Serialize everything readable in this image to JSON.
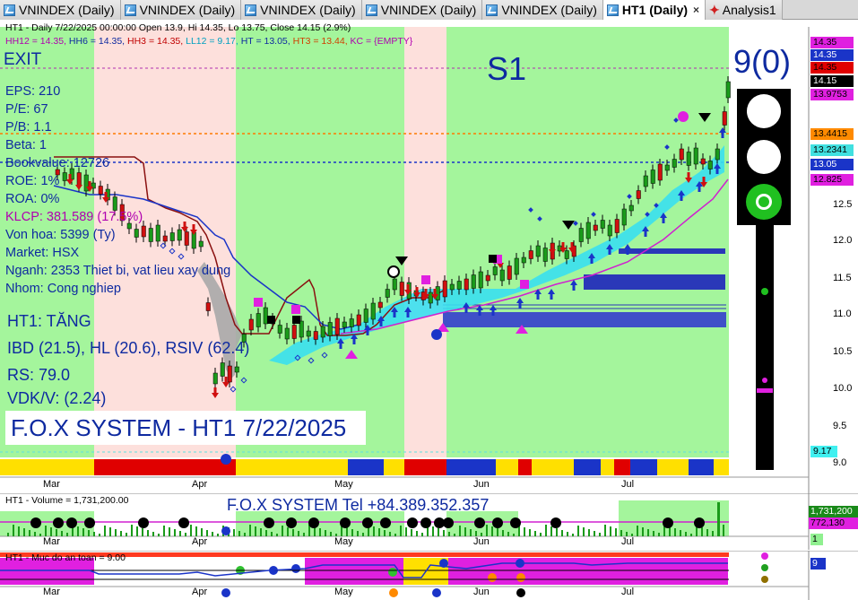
{
  "tabs": [
    {
      "label": "VNINDEX (Daily)",
      "icon": "chart-icon",
      "active": false
    },
    {
      "label": "VNINDEX (Daily)",
      "icon": "chart-icon",
      "active": false
    },
    {
      "label": "VNINDEX (Daily)",
      "icon": "chart-icon",
      "active": false
    },
    {
      "label": "VNINDEX (Daily)",
      "icon": "chart-icon",
      "active": false
    },
    {
      "label": "VNINDEX (Daily)",
      "icon": "chart-icon",
      "active": false
    },
    {
      "label": "HT1 (Daily)",
      "icon": "chart-icon",
      "active": true,
      "close": "×"
    },
    {
      "label": "Analysis1",
      "icon": "analysis-icon",
      "active": false
    }
  ],
  "chart": {
    "header_line1": "HT1 - Daily 7/22/2025 00:00:00 Open 13.9, Hi 14.35, Lo 13.75, Close 14.15 (2.9%)",
    "header_line2": [
      {
        "text": "HH12 = 14.35, ",
        "color": "#b000b0"
      },
      {
        "text": "HH6 = 14.35, ",
        "color": "#0e2aa0"
      },
      {
        "text": "HH3 = 14.35, ",
        "color": "#c00000"
      },
      {
        "text": "LL12 = 9.17, ",
        "color": "#00a0c0"
      },
      {
        "text": "HT = 13.05, ",
        "color": "#0e2aa0"
      },
      {
        "text": "HT3 = 13.44, ",
        "color": "#d04000"
      },
      {
        "text": "KC = {EMPTY}",
        "color": "#b000b0"
      }
    ],
    "signal_exit": "EXIT",
    "signal_s1": "S1",
    "signal_count": "9(0)",
    "fundamentals": [
      {
        "text": "EPS: 210",
        "color": "#0e2aa0"
      },
      {
        "text": "P/E: 67",
        "color": "#0e2aa0"
      },
      {
        "text": "P/B: 1.1",
        "color": "#0e2aa0"
      },
      {
        "text": "Beta: 1",
        "color": "#0e2aa0"
      },
      {
        "text": "Bookvalue: 12726",
        "color": "#0e2aa0"
      },
      {
        "text": "ROE: 1%",
        "color": "#0e2aa0"
      },
      {
        "text": "ROA: 0%",
        "color": "#0e2aa0"
      },
      {
        "text": "KLCP: 381.589 (17.5%)",
        "color": "#b000b0"
      },
      {
        "text": "Von hoa: 5399 (Ty)",
        "color": "#0e2aa0"
      },
      {
        "text": "Market: HSX",
        "color": "#0e2aa0"
      },
      {
        "text": "Nganh: 2353 Thiet bi, vat lieu xay dung",
        "color": "#0e2aa0"
      },
      {
        "text": "Nhom: Cong nghiep",
        "color": "#0e2aa0"
      }
    ],
    "stats": [
      "HT1: TĂNG",
      "IBD (21.5), HL (20.6), RSIV (62.4)",
      "RS: 79.0",
      "VDK/V:  (2.24)"
    ],
    "system_title": "F.O.X SYSTEM - HT1 7/22/2025",
    "y_axis": [
      "12.5",
      "12.0",
      "11.5",
      "11.0",
      "10.5",
      "10.0",
      "9.5",
      "9.0"
    ],
    "price_tags": [
      {
        "text": "14.35",
        "bg": "#e020e0",
        "fg": "#000"
      },
      {
        "text": "14.35",
        "bg": "#1a34c8",
        "fg": "#fff"
      },
      {
        "text": "14.35",
        "bg": "#e00000",
        "fg": "#000"
      },
      {
        "text": "14.15",
        "bg": "#000000",
        "fg": "#fff"
      },
      {
        "text": "13.9753",
        "bg": "#e020e0",
        "fg": "#000"
      },
      {
        "text": "13.4415",
        "bg": "#ff8a00",
        "fg": "#000"
      },
      {
        "text": "13.2341",
        "bg": "#40e0e0",
        "fg": "#000"
      },
      {
        "text": "13.05",
        "bg": "#1a34c8",
        "fg": "#fff"
      },
      {
        "text": "12.825",
        "bg": "#e020e0",
        "fg": "#000"
      },
      {
        "text": "9.17",
        "bg": "#40f0f0",
        "fg": "#000"
      }
    ],
    "x_axis": [
      "Mar",
      "Apr",
      "May",
      "Jun",
      "Jul"
    ]
  },
  "volume": {
    "header": "HT1 - Volume = 1,731,200.00",
    "tel": "F.O.X SYSTEM Tel +84.389.352.357",
    "tags": [
      {
        "text": "1,731,200",
        "bg": "#1a8a1a",
        "fg": "#fff"
      },
      {
        "text": "772,130",
        "bg": "#e020e0",
        "fg": "#000"
      },
      {
        "text": "1",
        "bg": "#90f090",
        "fg": "#000"
      }
    ],
    "x_axis": [
      "Mar",
      "Apr",
      "May",
      "Jun",
      "Jul"
    ]
  },
  "safety": {
    "header": "HT1 - Muc do an toan = 9.00",
    "tag": {
      "text": "9",
      "bg": "#1a34c8",
      "fg": "#fff"
    },
    "x_axis": [
      "Mar",
      "Apr",
      "May",
      "Jun",
      "Jul"
    ]
  },
  "colors": {
    "green_zone": "#a4f59c",
    "pink_zone": "#fde0dc",
    "accent_blue": "#0e2aa0"
  }
}
